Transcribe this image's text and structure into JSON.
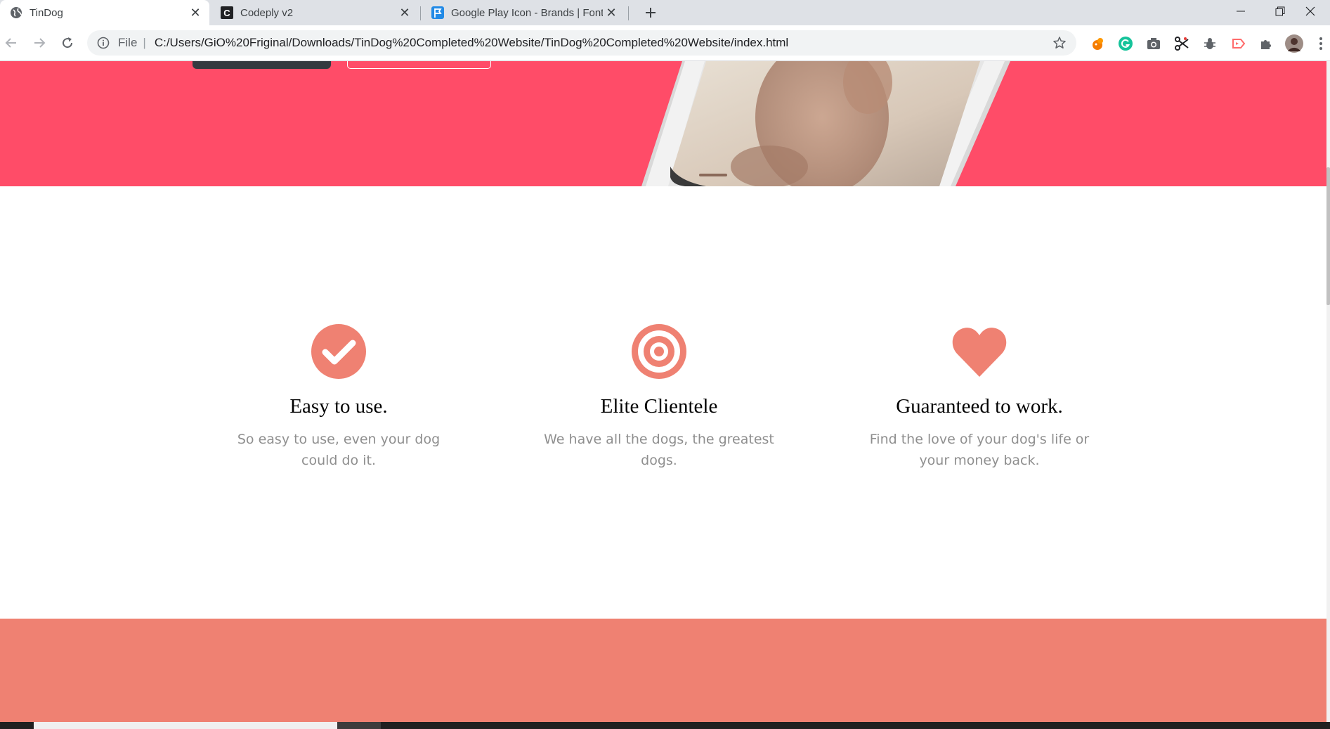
{
  "browser": {
    "tabs": [
      {
        "title": "TinDog",
        "active": true,
        "favicon": "globe-icon"
      },
      {
        "title": "Codeply v2",
        "active": false,
        "favicon": "codeply-c-icon"
      },
      {
        "title": "Google Play Icon - Brands | Font",
        "active": false,
        "favicon": "fontawesome-flag-icon"
      }
    ],
    "address": {
      "scheme_label": "File",
      "separator": "|",
      "url": "C:/Users/GiO%20Friginal/Downloads/TinDog%20Completed%20Website/TinDog%20Completed%20Website/index.html"
    },
    "extensions": [
      "squirrel-icon",
      "grammarly-icon",
      "camera-icon",
      "scissors-icon",
      "bug-icon",
      "cast-icon",
      "puzzle-icon",
      "profile-avatar"
    ]
  },
  "features": [
    {
      "icon": "check-circle-icon",
      "title": "Easy to use.",
      "text": "So easy to use, even your dog could do it."
    },
    {
      "icon": "bullseye-icon",
      "title": "Elite Clientele",
      "text": "We have all the dogs, the greatest dogs."
    },
    {
      "icon": "heart-icon",
      "title": "Guaranteed to work.",
      "text": "Find the love of your dog's life or your money back."
    }
  ],
  "colors": {
    "hero": "#ff4c68",
    "accent": "#ef8172",
    "dark_button": "#343a40",
    "feature_text": "#8f8f8f"
  }
}
